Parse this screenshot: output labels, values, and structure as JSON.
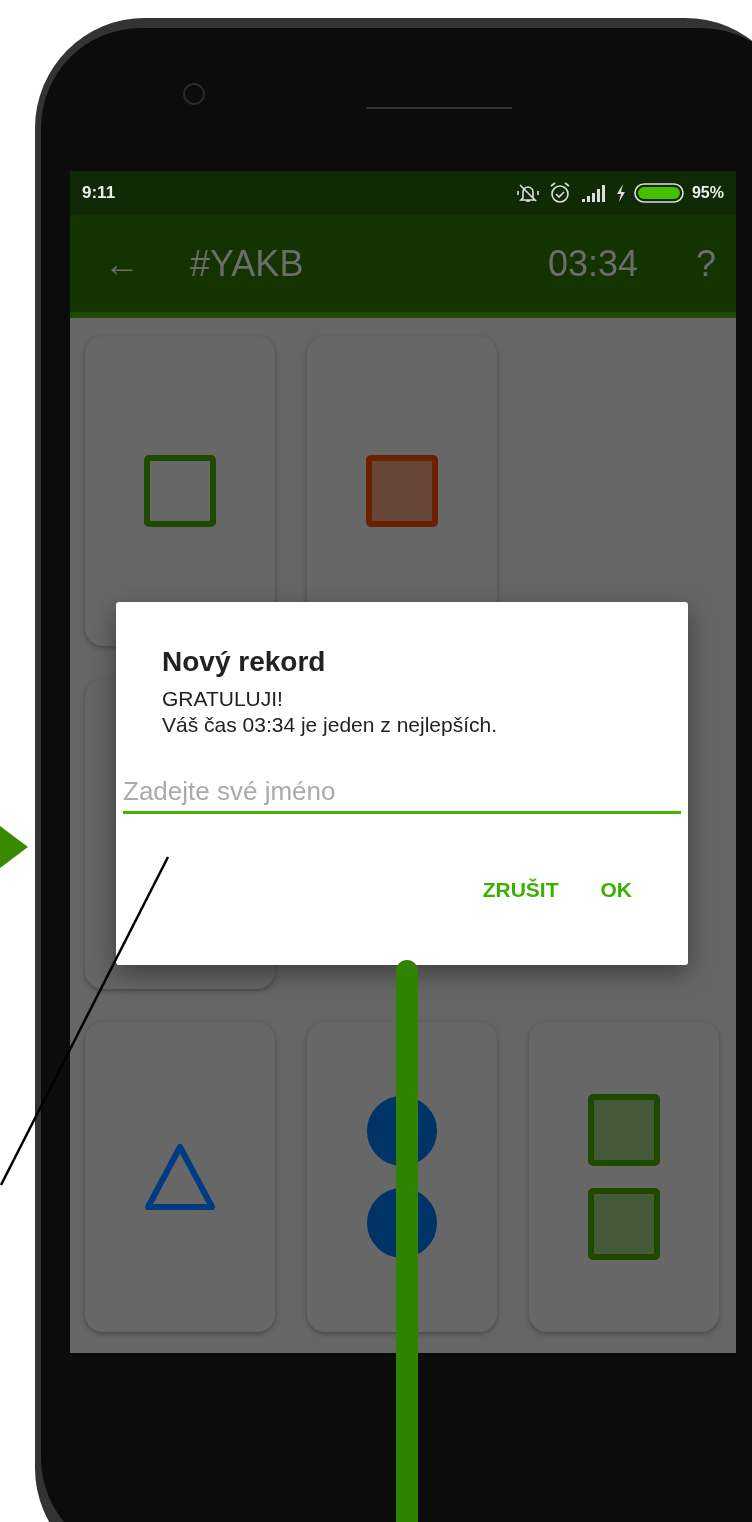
{
  "status_bar": {
    "time": "9:11",
    "battery": "95%"
  },
  "app_bar": {
    "back": "←",
    "title": "#YAKB",
    "timer": "03:34",
    "help": "?"
  },
  "card_rows": [
    {
      "cards": [
        {
          "kind": "shapes",
          "shapes": [
            {
              "kind": "square",
              "filled": false,
              "color": "#1e4a00"
            }
          ]
        },
        {
          "kind": "shapes",
          "shapes": [
            {
              "kind": "square",
              "filled": true,
              "color": "#6b2000"
            }
          ]
        }
      ]
    },
    {
      "cards": [
        {
          "kind": "covered"
        }
      ]
    },
    {
      "cards": [
        {
          "kind": "shapes",
          "shapes": [
            {
              "kind": "triangle",
              "filled": false,
              "color": "#003a80"
            }
          ]
        },
        {
          "kind": "shapes",
          "shapes": [
            {
              "kind": "circle",
              "filled": true,
              "color": "#003366"
            },
            {
              "kind": "circle",
              "filled": true,
              "color": "#003366"
            }
          ]
        },
        {
          "kind": "shapes",
          "shapes": [
            {
              "kind": "square",
              "filled": true,
              "color": "#1e4a00"
            },
            {
              "kind": "square",
              "filled": true,
              "color": "#1e4a00"
            }
          ]
        }
      ]
    }
  ],
  "dialog": {
    "title": "Nový rekord",
    "lines": [
      "GRATULUJI!",
      "Váš čas 03:34 je jeden z nejlepších."
    ],
    "input": {
      "placeholder": "Zadejte své jméno"
    },
    "buttons": [
      "ZRUŠIT",
      "OK"
    ]
  }
}
